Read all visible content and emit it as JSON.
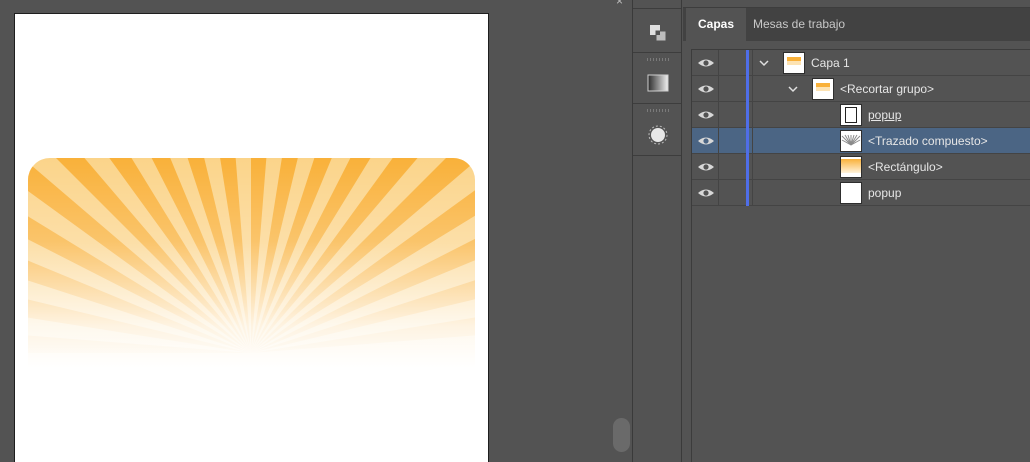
{
  "window": {
    "close_glyph": "×"
  },
  "tabs": [
    {
      "label": "Capas",
      "active": true
    },
    {
      "label": "Mesas de trabajo",
      "active": false
    }
  ],
  "layers": [
    {
      "label": "Capa 1",
      "indent": 0,
      "expanded": true,
      "selected": false,
      "underline": false,
      "thumb": "gradient-top"
    },
    {
      "label": "<Recortar grupo>",
      "indent": 1,
      "expanded": true,
      "selected": false,
      "underline": false,
      "thumb": "gradient-top"
    },
    {
      "label": "popup",
      "indent": 2,
      "expanded": null,
      "selected": false,
      "underline": true,
      "thumb": "outline"
    },
    {
      "label": "<Trazado compuesto>",
      "indent": 2,
      "expanded": null,
      "selected": true,
      "underline": false,
      "thumb": "rays"
    },
    {
      "label": "<Rectángulo>",
      "indent": 2,
      "expanded": null,
      "selected": false,
      "underline": false,
      "thumb": "gradient-full"
    },
    {
      "label": "popup",
      "indent": 2,
      "expanded": null,
      "selected": false,
      "underline": false,
      "thumb": "blank"
    }
  ],
  "colors": {
    "layer_color": "#4f6ee8",
    "selection": "#4b6584",
    "art_orange": "#f9b13a",
    "panel_bg": "#535353"
  },
  "icons": {
    "tool1": "pathfinder-icon",
    "tool2": "gradient-icon",
    "tool3": "appearance-icon",
    "visibility": "eye-icon",
    "expand": "chevron-down-icon"
  }
}
